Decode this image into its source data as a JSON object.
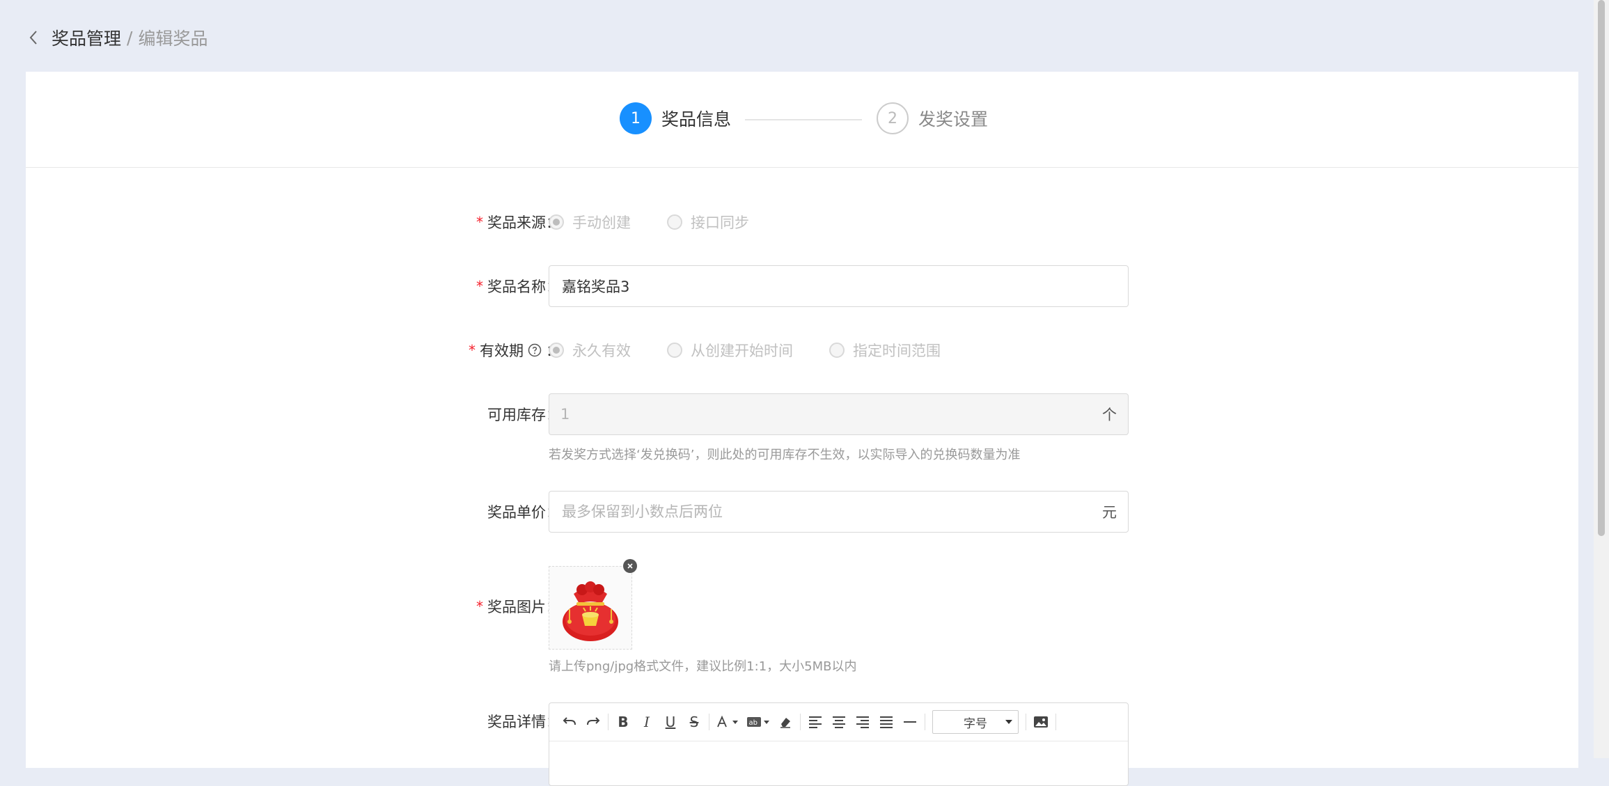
{
  "breadcrumb": {
    "parent": "奖品管理",
    "separator": "/",
    "current": "编辑奖品"
  },
  "steps": [
    {
      "number": "1",
      "label": "奖品信息",
      "state": "active"
    },
    {
      "number": "2",
      "label": "发奖设置",
      "state": "pending"
    }
  ],
  "form": {
    "source": {
      "label": "奖品来源",
      "colon": "：",
      "options": [
        "手动创建",
        "接口同步"
      ],
      "selected": "手动创建"
    },
    "name": {
      "label": "奖品名称",
      "colon": "：",
      "value": "嘉铭奖品3"
    },
    "validity": {
      "label": "有效期",
      "colon": "：",
      "options": [
        "永久有效",
        "从创建开始时间",
        "指定时间范围"
      ],
      "selected": "永久有效"
    },
    "stock": {
      "label": "可用库存",
      "colon": "：",
      "value": "1",
      "suffix": "个",
      "hint": "若发奖方式选择‘发兑换码’，则此处的可用库存不生效，以实际导入的兑换码数量为准"
    },
    "price": {
      "label": "奖品单价",
      "colon": "：",
      "placeholder": "最多保留到小数点后两位",
      "suffix": "元"
    },
    "image": {
      "label": "奖品图片",
      "colon": "：",
      "hint": "请上传png/jpg格式文件，建议比例1:1，大小5MB以内"
    },
    "detail": {
      "label": "奖品详情",
      "colon": "：",
      "font_size_label": "字号"
    }
  },
  "colors": {
    "primary": "#1890ff",
    "required": "#f5222d",
    "background": "#e8ecf5"
  }
}
